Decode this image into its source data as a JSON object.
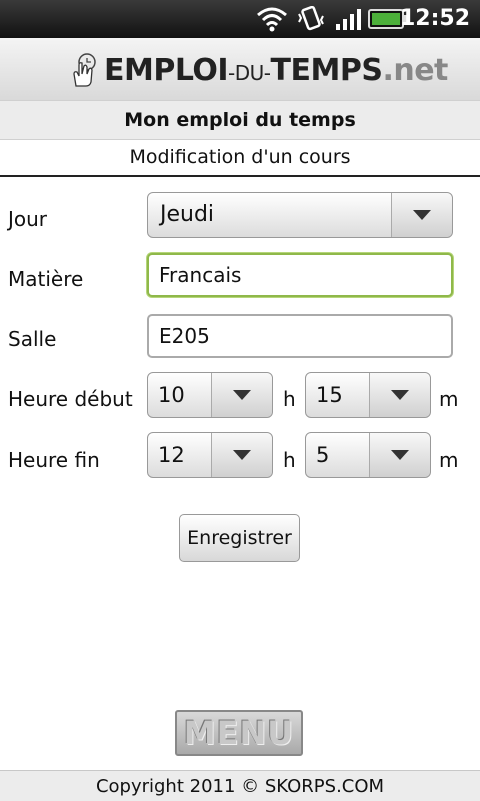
{
  "status_bar": {
    "time": "12:52"
  },
  "header": {
    "logo_part1": "EMPLOI",
    "logo_part2": "-DU-",
    "logo_part3": "TEMPS",
    "logo_part4": ".net"
  },
  "page": {
    "title": "Mon emploi du temps",
    "subtitle": "Modification d'un cours"
  },
  "form": {
    "jour": {
      "label": "Jour",
      "value": "Jeudi"
    },
    "matiere": {
      "label": "Matière",
      "value": "Francais"
    },
    "salle": {
      "label": "Salle",
      "value": "E205"
    },
    "heure_debut": {
      "label": "Heure début",
      "hour": "10",
      "minute": "15",
      "hour_unit": "h",
      "minute_unit": "m"
    },
    "heure_fin": {
      "label": "Heure fin",
      "hour": "12",
      "minute": "5",
      "hour_unit": "h",
      "minute_unit": "m"
    },
    "save_label": "Enregistrer"
  },
  "menu_label": "MENU",
  "footer": {
    "copyright": "Copyright 2011 © SKORPS.COM"
  },
  "colors": {
    "focus_border": "#8fb84a",
    "battery": "#4caf3a"
  },
  "icons": [
    "wifi-icon",
    "vibrate-icon",
    "signal-icon",
    "battery-icon",
    "hand-pointer-icon",
    "chevron-down-icon"
  ]
}
